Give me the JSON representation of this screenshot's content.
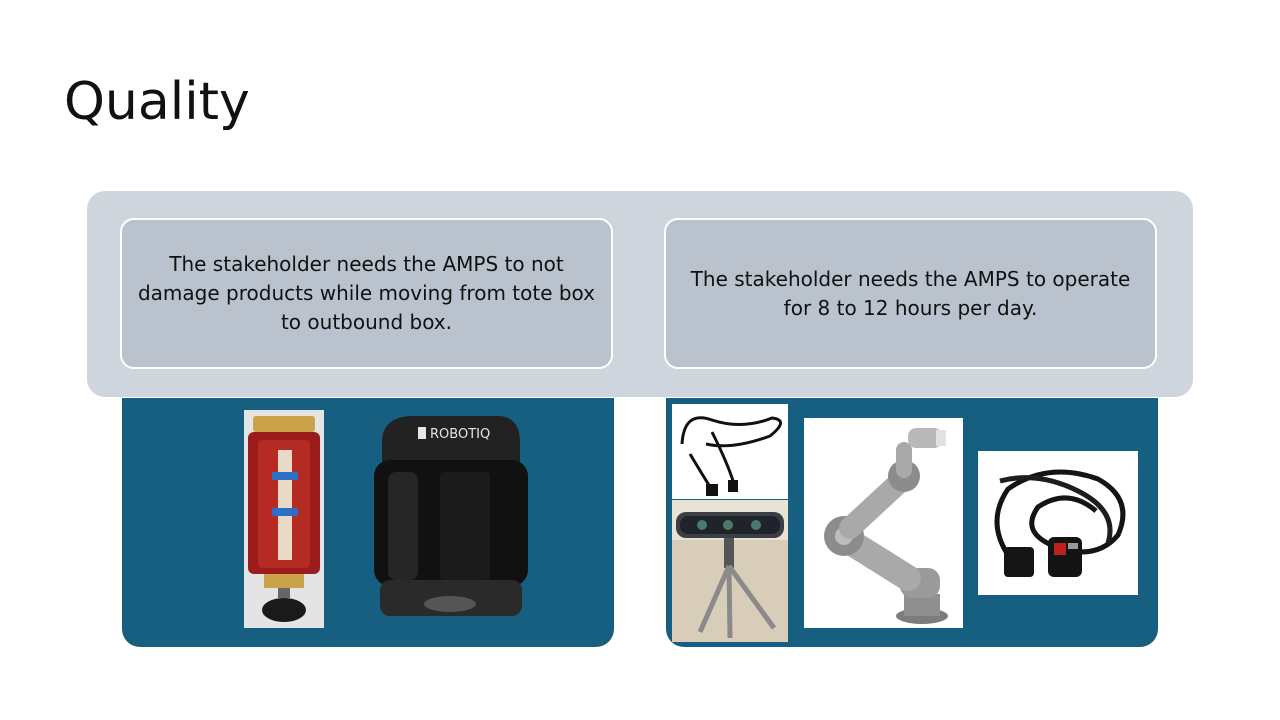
{
  "slide": {
    "title": "Quality",
    "cards": [
      {
        "text": "The stakeholder needs the AMPS to not damage products while moving from tote box to outbound box."
      },
      {
        "text": "The stakeholder needs the AMPS to operate for 8 to 12 hours per day."
      }
    ],
    "gripper_brand": "ROBOTIQ",
    "colors": {
      "panel": "#175f81",
      "band": "#cfd5dc",
      "card": "#bac3cd"
    },
    "images": [
      "suction-cup-gripper",
      "robotiq-gripper",
      "usb-cable",
      "depth-camera-tripod",
      "robot-arm",
      "power-cable"
    ]
  }
}
